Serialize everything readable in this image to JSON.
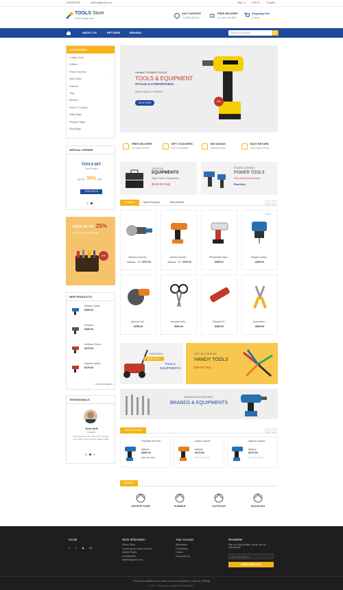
{
  "topbar": {
    "phone": "1234567890",
    "email": "admin@gmail.com",
    "signin": "Sign In",
    "currency": "USD $",
    "language": "English"
  },
  "header": {
    "logo_main": "TOOLS",
    "logo_sub": "Store",
    "tagline": "Online Mega store",
    "support_title": "24X7 SUPPORT",
    "support_sub": "+1 (999) 455 600",
    "delivery_title": "FREE DELIVERY",
    "delivery_sub": "on order over $99",
    "cart_title": "Shopping Cart",
    "cart_sub": "0 Items"
  },
  "nav": {
    "about": "ABOUT US",
    "returns": "RETURNS",
    "brands": "BRANDS",
    "search_placeholder": "Search our catalog"
  },
  "categories": {
    "title": "CATEGORIES",
    "items": [
      "Cutting Tools",
      "Drillbits",
      "Power Hammer",
      "Saws Drills",
      "Fasteria",
      "Tape",
      "Blinders",
      "Bolts & Pouches",
      "Utility Bags",
      "Shopper Bags",
      "Sling Bags"
    ]
  },
  "special_offers": {
    "title": "SPECIAL OFFERS",
    "name": "TOOLS SET",
    "sub": "Card Empire",
    "upto": "UP TO",
    "pct": "35%",
    "off": "OFF",
    "btn": "TOOLSET20"
  },
  "save_banner": {
    "line1": "SAVE UP TO",
    "pct": "25%",
    "line2": "ON SELECTED ITEMS",
    "sticker": "5%"
  },
  "new_products": {
    "title": "NEW PRODUCTS",
    "items": [
      {
        "name": "Aliquam Quaer...",
        "price": "$399.00"
      },
      {
        "name": "Voluptas ...",
        "price": "$399.00"
      },
      {
        "name": "Similique Sunte...",
        "price": "$379.53"
      },
      {
        "name": "Aspetur Autodit...",
        "price": "$379.53"
      }
    ],
    "all": "All new products »"
  },
  "testimonials": {
    "title": "TESTIMONIALS",
    "name": "John duff",
    "role": "Designer",
    "text": "Duis faucibus enim vitae nunc molestie, nec facilisis arcu pulvinar nullam mattis."
  },
  "hero": {
    "brand": "DeWALT POWER TOOLS",
    "title": "TOOLS & EQUIPMENT",
    "subtitle": "STYLUS & CONFORTABLE",
    "catalog": "NEW CATALOG DESIGN",
    "btn": "SHOP NOW",
    "badge": "18v"
  },
  "features": [
    {
      "title": "FREE DELIVERY",
      "sub": "On Orders Of $99"
    },
    {
      "title": "GIFT VOUCHERS",
      "sub": "Free Of Available"
    },
    {
      "title": "BIG SAVING",
      "sub": "Weekend Sales"
    },
    {
      "title": "EASY RETURN",
      "sub": "100% Return Policy"
    }
  ],
  "promo1": {
    "tag": "TOOLS KIT",
    "title": "EQUIPMENTS",
    "sub": "28pcs Tools & Equipments",
    "price": "$149.00 Only"
  },
  "promo2": {
    "tag": "POWER COMPANY",
    "title": "POWER TOOLS",
    "sub": "20w power performance",
    "link": "Read More"
  },
  "tabs": {
    "featured": "Featured",
    "new": "New Products",
    "best": "Best Sellers"
  },
  "products": [
    {
      "name": "Aliquam Quaerat...",
      "old": "$399.00",
      "off": "-5%",
      "price": "$379.53"
    },
    {
      "name": "Aspetur Autodit...",
      "old": "$399.00",
      "off": "-5%",
      "price": "$379.53"
    },
    {
      "name": "Perspiciatis Unde...",
      "old": "",
      "off": "",
      "price": "$689.51"
    },
    {
      "name": "Aliquam Quaer...",
      "old": "",
      "off": "",
      "price": "$399.00",
      "flag": "Fresh"
    },
    {
      "name": "Quaerat Voll...",
      "old": "",
      "off": "",
      "price": "$255.99"
    },
    {
      "name": "Voluptas Nulla...",
      "old": "",
      "off": "",
      "price": "$526.99"
    },
    {
      "name": "Voluptas Et...",
      "old": "",
      "off": "",
      "price": "$399.00"
    },
    {
      "name": "Quis Autem...",
      "old": "",
      "off": "",
      "price": "$599.99"
    }
  ],
  "banner_garden": {
    "tag": "GARDENING",
    "stock": "NEW STOCK",
    "title": "TOOLS EQUIPMENTS"
  },
  "banner_handy": {
    "tag": "GET THE JOB DONE",
    "title": "HANDY TOOLS",
    "price": "$49.00 Only"
  },
  "banner_brands": {
    "tag": "BRANDED ACCESSORIES",
    "title": "BRANDS & EQUIPMENTS"
  },
  "special_product": {
    "title": "Special Product",
    "items": [
      {
        "name": "Voluptate Velit Esse",
        "old": "$399.00",
        "price": "$396.00",
        "btn": "ADD TO CART"
      },
      {
        "name": "Aspetur Autodit...",
        "old": "$399.00",
        "price": "$379.53",
        "btn": "OUT OF STOCK"
      },
      {
        "name": "Aliquam Quaerat...",
        "old": "$399.00",
        "price": "$379.53",
        "btn": "OUT OF STOCK"
      }
    ]
  },
  "brands": {
    "title": "BRANDS",
    "logos": [
      "GRUPPE FARB",
      "SUMMER",
      "OUTDOOR",
      "MOUNTAIN"
    ]
  },
  "footer": {
    "social": "Social",
    "store": "Store Information",
    "store_lines": [
      "Demo Store",
      "Lorem ipsum dolor sit amet",
      "United States",
      "1234567890",
      "admin@gmail.com"
    ],
    "account": "Your Account",
    "account_lines": [
      "Addresses",
      "Credit slips",
      "Orders",
      "Personal info"
    ],
    "newsletter": "Newsletter",
    "news_text": "Sign up to get updates, please use our subscription!",
    "email_placeholder": "Your email address",
    "subscribe": "SUBSCRIBE NOW",
    "links": "Terms and conditions of use | About us | Secure payment | Contact us | Sitemap",
    "copyright": "© 2017 - Ecommerce software by PrestaShop™"
  }
}
